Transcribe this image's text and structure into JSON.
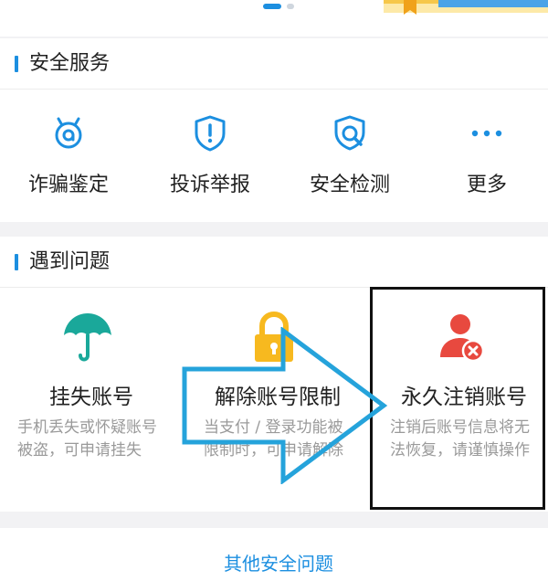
{
  "carousel": {
    "active_index": 0,
    "count": 2
  },
  "colors": {
    "accent": "#1c8fe0",
    "green_umbrella": "#1aa89a",
    "lock_yellow": "#f7b91f",
    "red_user": "#e8493f",
    "desc_gray": "#9a9a9a"
  },
  "security_services": {
    "title": "安全服务",
    "items": [
      {
        "label": "诈骗鉴定",
        "icon": "fraud-detect-icon"
      },
      {
        "label": "投诉举报",
        "icon": "shield-exclamation-icon"
      },
      {
        "label": "安全检测",
        "icon": "shield-search-icon"
      },
      {
        "label": "更多",
        "icon": "more-dots-icon"
      }
    ]
  },
  "problems": {
    "title": "遇到问题",
    "items": [
      {
        "title": "挂失账号",
        "desc": "手机丢失或怀疑账号被盗，可申请挂失",
        "icon": "umbrella-icon"
      },
      {
        "title": "解除账号限制",
        "desc": "当支付 / 登录功能被限制时，可申请解除",
        "icon": "lock-icon"
      },
      {
        "title": "永久注销账号",
        "desc": "注销后账号信息将无法恢复，请谨慎操作",
        "icon": "user-remove-icon"
      }
    ]
  },
  "footer": {
    "link": "其他安全问题"
  }
}
